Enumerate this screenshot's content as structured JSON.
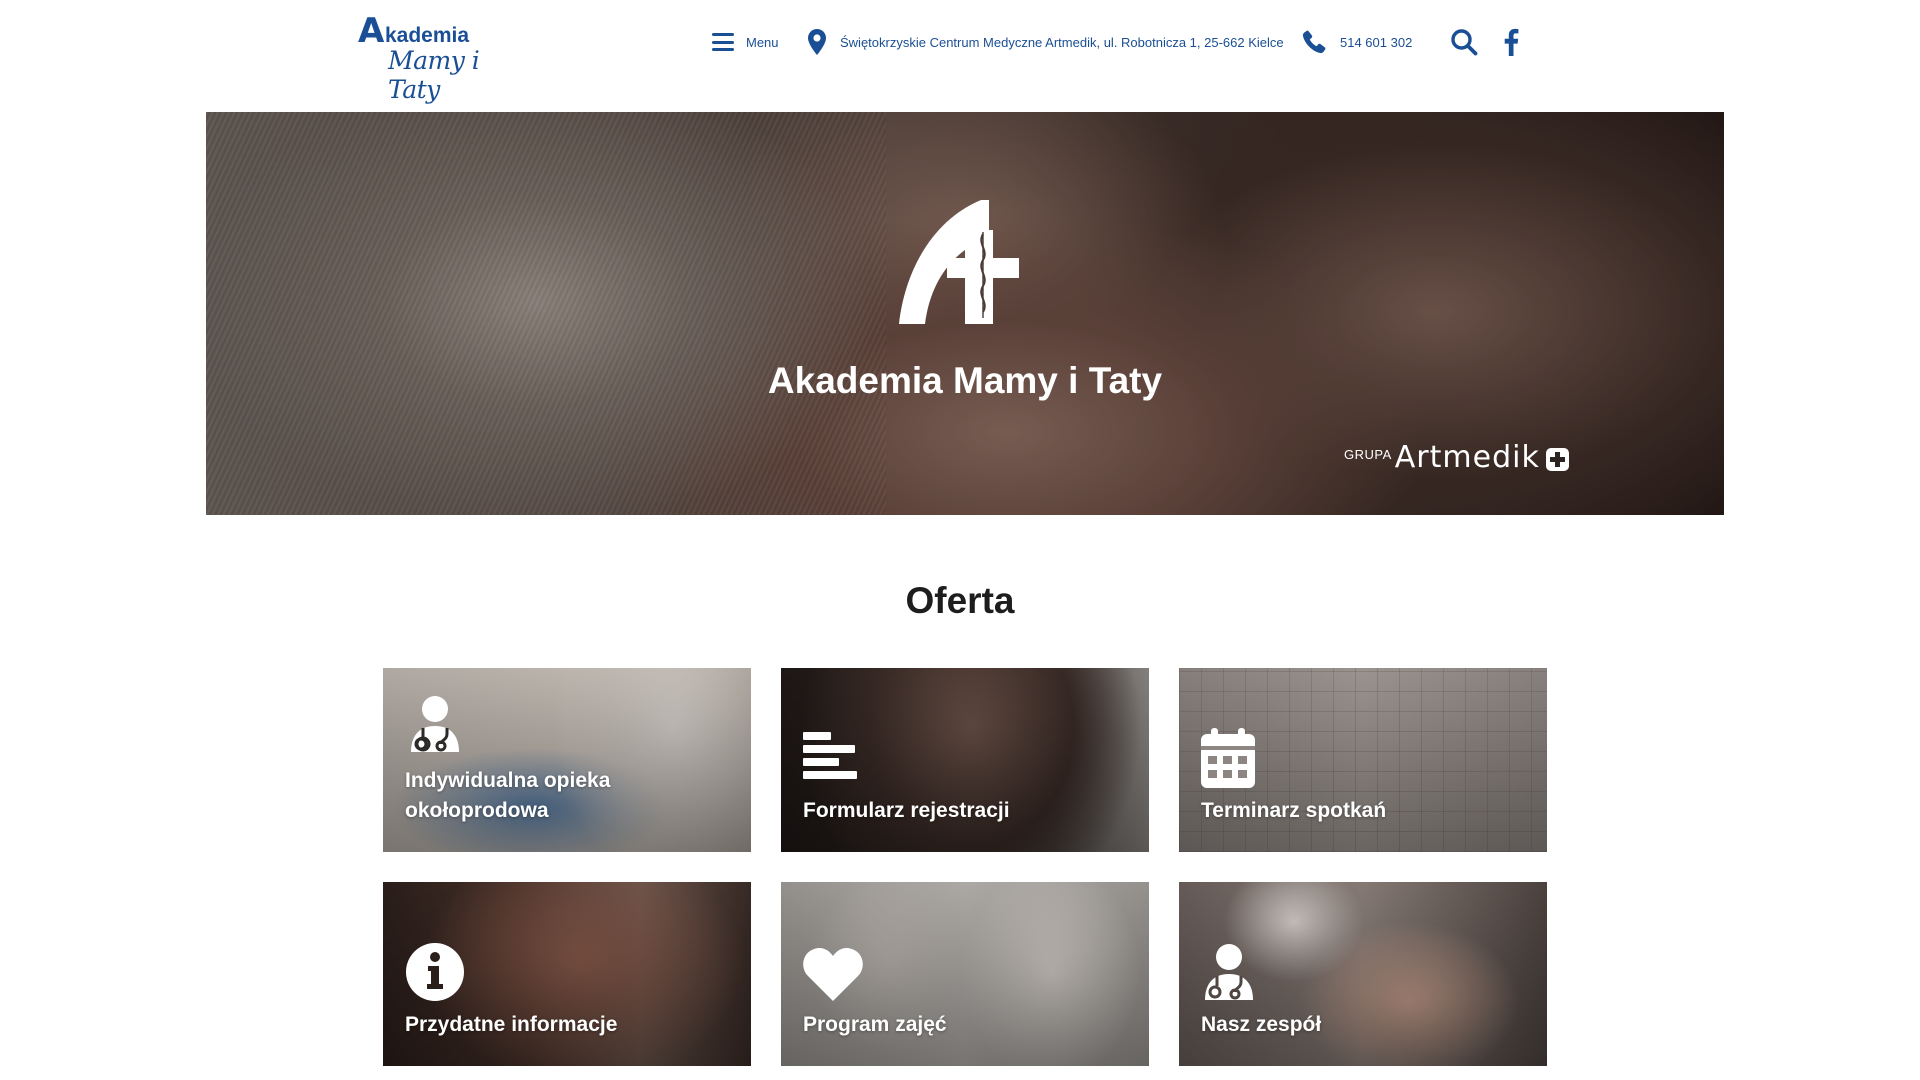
{
  "header": {
    "logo_word": "kademia",
    "logo_letter": "A",
    "logo_script": "Mamy i Taty",
    "menu_label": "Menu",
    "address": "Świętokrzyskie Centrum Medyczne Artmedik, ul. Robotnicza 1, 25-662 Kielce",
    "phone": "514 601 302",
    "icons": {
      "menu": "hamburger-icon",
      "address": "map-pin-icon",
      "phone": "phone-icon",
      "search": "search-icon",
      "facebook": "facebook-icon"
    }
  },
  "hero": {
    "title": "Akademia Mamy i Taty",
    "brand_prefix": "GRUPA",
    "brand_name": "Artmedik"
  },
  "offer": {
    "title": "Oferta",
    "cards": [
      {
        "label": "Indywidualna opieka okołoprodowa",
        "icon": "doctor-icon"
      },
      {
        "label": "Formularz rejestracji",
        "icon": "form-lines-icon"
      },
      {
        "label": "Terminarz spotkań",
        "icon": "calendar-icon"
      },
      {
        "label": "Przydatne informacje",
        "icon": "info-icon"
      },
      {
        "label": "Program zajęć",
        "icon": "heart-icon"
      },
      {
        "label": "Nasz zespół",
        "icon": "doctor-icon"
      }
    ]
  },
  "colors": {
    "brand_blue": "#1a4f95",
    "heading": "#1d1d1d",
    "white": "#ffffff"
  }
}
